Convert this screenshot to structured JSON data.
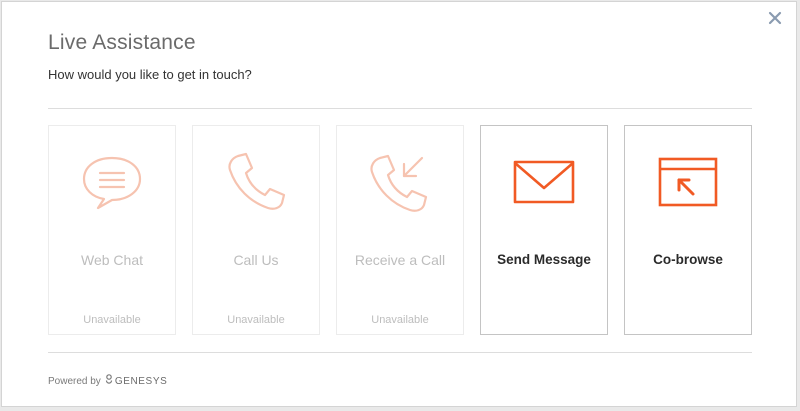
{
  "dialog": {
    "title": "Live Assistance",
    "subtitle": "How would you like to get in touch?",
    "close_icon": "close-icon"
  },
  "options": [
    {
      "label": "Web Chat",
      "status": "Unavailable",
      "available": false,
      "icon": "chat-bubble-icon"
    },
    {
      "label": "Call Us",
      "status": "Unavailable",
      "available": false,
      "icon": "phone-icon"
    },
    {
      "label": "Receive a Call",
      "status": "Unavailable",
      "available": false,
      "icon": "phone-incoming-icon"
    },
    {
      "label": "Send Message",
      "status": "",
      "available": true,
      "icon": "envelope-icon"
    },
    {
      "label": "Co-browse",
      "status": "",
      "available": true,
      "icon": "cobrowse-window-icon"
    }
  ],
  "footer": {
    "powered_by": "Powered by",
    "brand": "GENESYS"
  },
  "colors": {
    "accent": "#f15a24",
    "disabled_icon": "#f6c3b0",
    "disabled_text": "#bdbdbd",
    "close": "#8a9bb0"
  }
}
